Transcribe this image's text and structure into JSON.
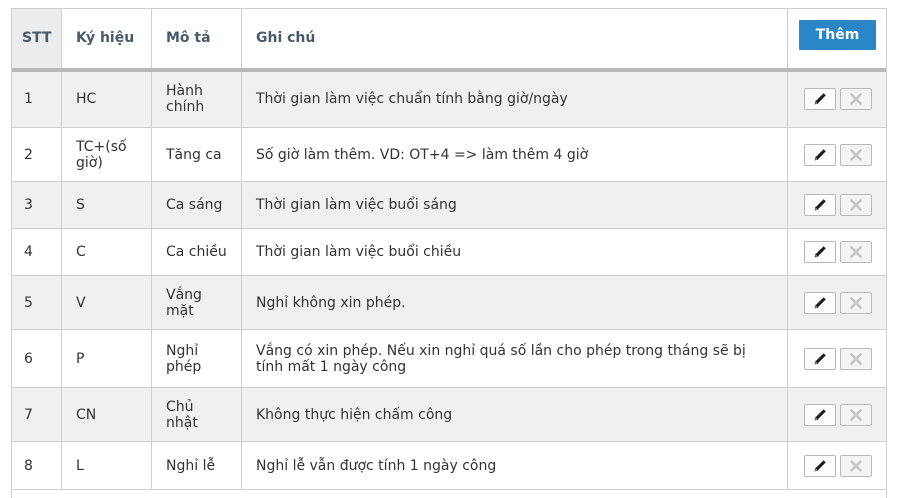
{
  "table": {
    "headers": {
      "stt": "STT",
      "symbol": "Ký hiệu",
      "description": "Mô tả",
      "note": "Ghi chú"
    },
    "add_label": "Thêm",
    "rows": [
      {
        "stt": "1",
        "symbol": "HC",
        "description": "Hành chính",
        "note": "Thời gian làm việc chuẩn tính bằng giờ/ngày"
      },
      {
        "stt": "2",
        "symbol": "TC+(số giờ)",
        "description": "Tăng ca",
        "note": "Số giờ làm thêm. VD: OT+4 => làm thêm 4 giờ"
      },
      {
        "stt": "3",
        "symbol": "S",
        "description": "Ca sáng",
        "note": "Thời gian làm việc buổi sáng"
      },
      {
        "stt": "4",
        "symbol": "C",
        "description": "Ca chiều",
        "note": "Thời gian làm việc buổi chiều"
      },
      {
        "stt": "5",
        "symbol": "V",
        "description": "Vắng mặt",
        "note": "Nghỉ không xin phép."
      },
      {
        "stt": "6",
        "symbol": "P",
        "description": "Nghỉ phép",
        "note": "Vắng có xin phép. Nếu xin nghỉ quá số lần cho phép trong tháng sẽ bị tính mất 1 ngày công"
      },
      {
        "stt": "7",
        "symbol": "CN",
        "description": "Chủ nhật",
        "note": "Không thực hiện chấm công"
      },
      {
        "stt": "8",
        "symbol": "L",
        "description": "Nghỉ lễ",
        "note": "Nghỉ lễ vẫn được tính 1 ngày công"
      }
    ]
  },
  "icons": {
    "edit": "pencil-icon",
    "delete": "close-icon"
  },
  "colors": {
    "accent": "#2b86c7",
    "row_alt": "#f0f0f0",
    "disabled_icon": "#c4c4c4"
  }
}
